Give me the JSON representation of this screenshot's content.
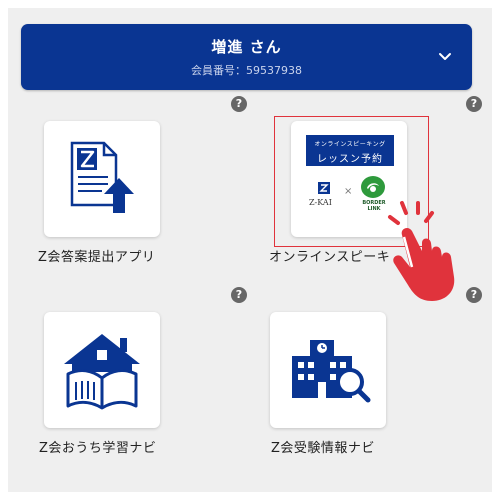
{
  "header": {
    "user_name": "増進 さん",
    "member_label": "会員番号：59537938"
  },
  "help_glyph": "?",
  "apps": [
    {
      "label": "Z会答案提出アプリ",
      "icon": "document-upload-icon"
    },
    {
      "label": "オンラインスピーキ",
      "icon": "online-speaking-lesson-logo",
      "banner_line1": "オンラインスピーキング",
      "banner_line2": "レッスン予約",
      "brand_left": "Z-KAI",
      "brand_right": "BORDER LINK",
      "times": "×"
    },
    {
      "label": "Z会おうち学習ナビ",
      "icon": "house-book-icon"
    },
    {
      "label": "Z会受験情報ナビ",
      "icon": "school-search-icon"
    }
  ],
  "colors": {
    "brand_navy": "#0a3592",
    "accent_red": "#e0333c",
    "help_gray": "#676767"
  }
}
